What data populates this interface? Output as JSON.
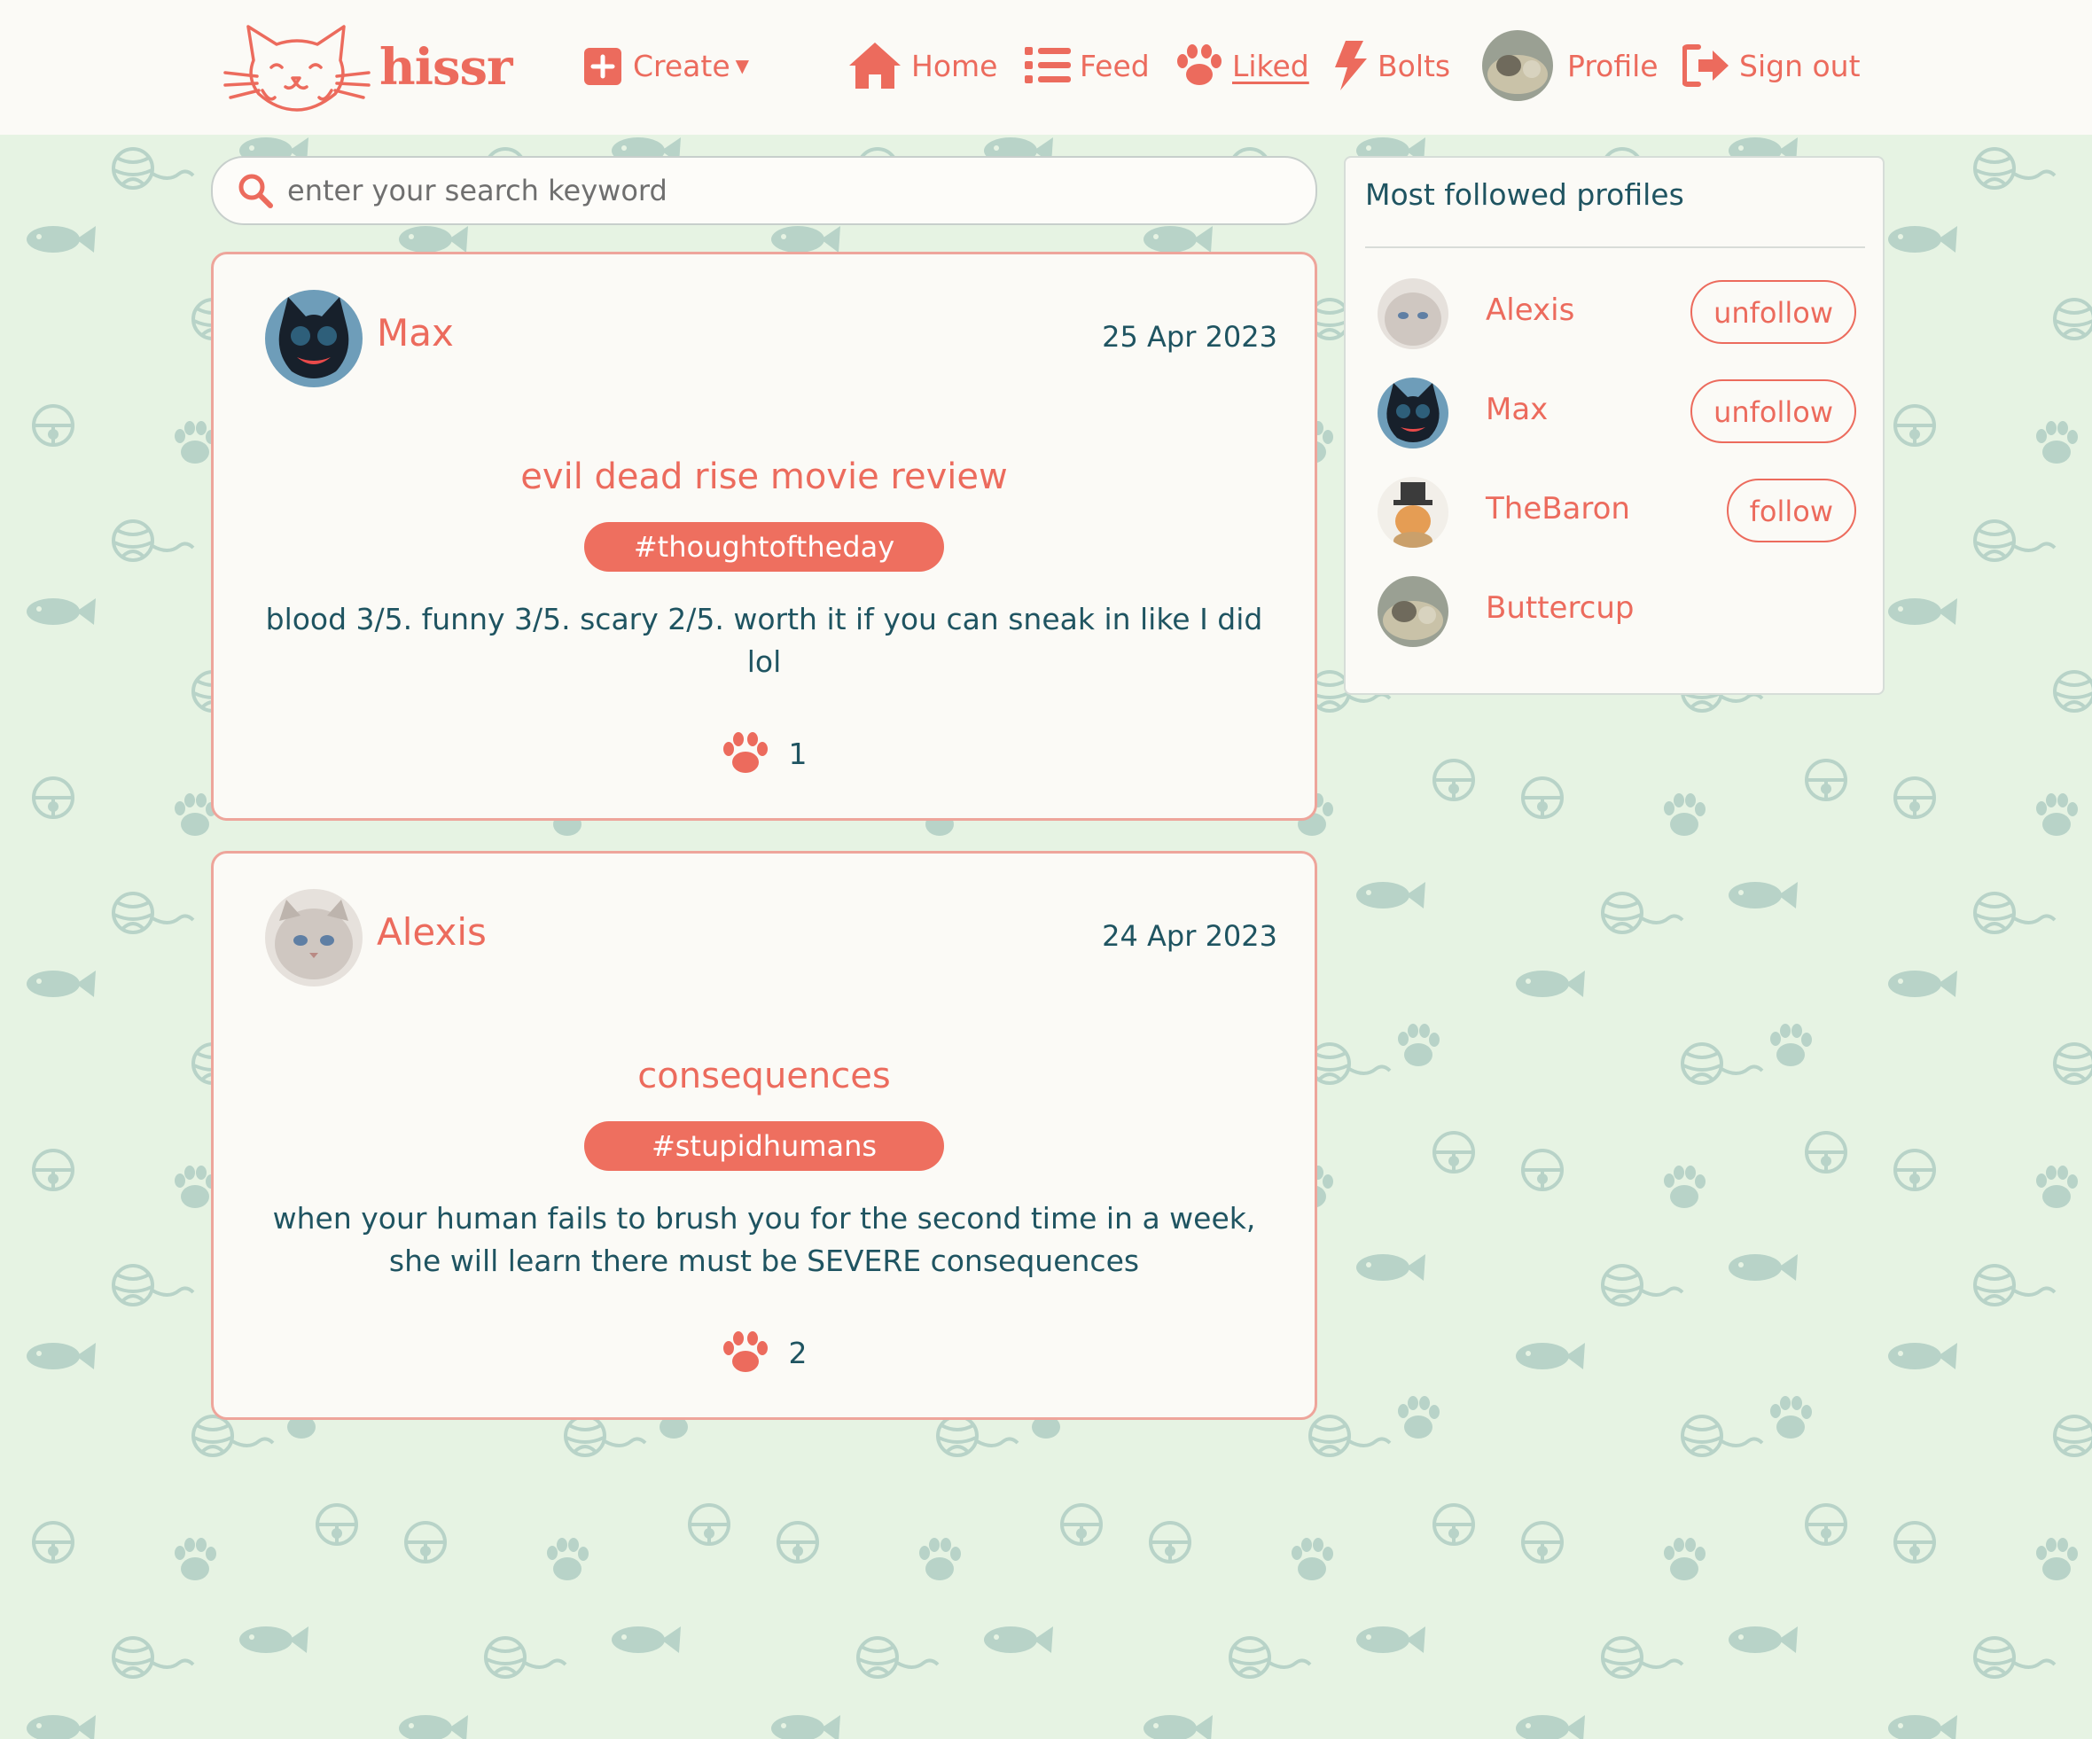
{
  "nav": {
    "brand": "hissr",
    "create": "Create",
    "home": "Home",
    "feed": "Feed",
    "liked": "Liked",
    "bolts": "Bolts",
    "profile": "Profile",
    "signout": "Sign out",
    "active": "liked"
  },
  "search": {
    "placeholder": "enter your search keyword"
  },
  "posts": [
    {
      "author": "Max",
      "date": "25 Apr 2023",
      "title": "evil dead rise movie review",
      "tag": "#thoughtoftheday",
      "body": "blood 3/5. funny 3/5. scary 2/5. worth it if you can sneak in like I did lol",
      "likes": "1"
    },
    {
      "author": "Alexis",
      "date": "24 Apr 2023",
      "title": "consequences",
      "tag": "#stupidhumans",
      "body": "when your human fails to brush you for the second time in a week, she will learn there must be SEVERE consequences",
      "likes": "2"
    }
  ],
  "sidebar": {
    "title": "Most followed profiles",
    "profiles": [
      {
        "name": "Alexis",
        "button": "unfollow"
      },
      {
        "name": "Max",
        "button": "unfollow"
      },
      {
        "name": "TheBaron",
        "button": "follow"
      },
      {
        "name": "Buttercup",
        "button": ""
      }
    ]
  },
  "colors": {
    "accent": "#ec6b5d",
    "text": "#1f5461",
    "background": "#e6f3e3",
    "card": "#fbfaf6",
    "doodles": "#b8d3c8"
  },
  "icons": [
    "cat-logo-icon",
    "plus-square-icon",
    "home-icon",
    "list-icon",
    "paw-icon",
    "bolt-icon",
    "sign-out-icon",
    "search-icon"
  ]
}
